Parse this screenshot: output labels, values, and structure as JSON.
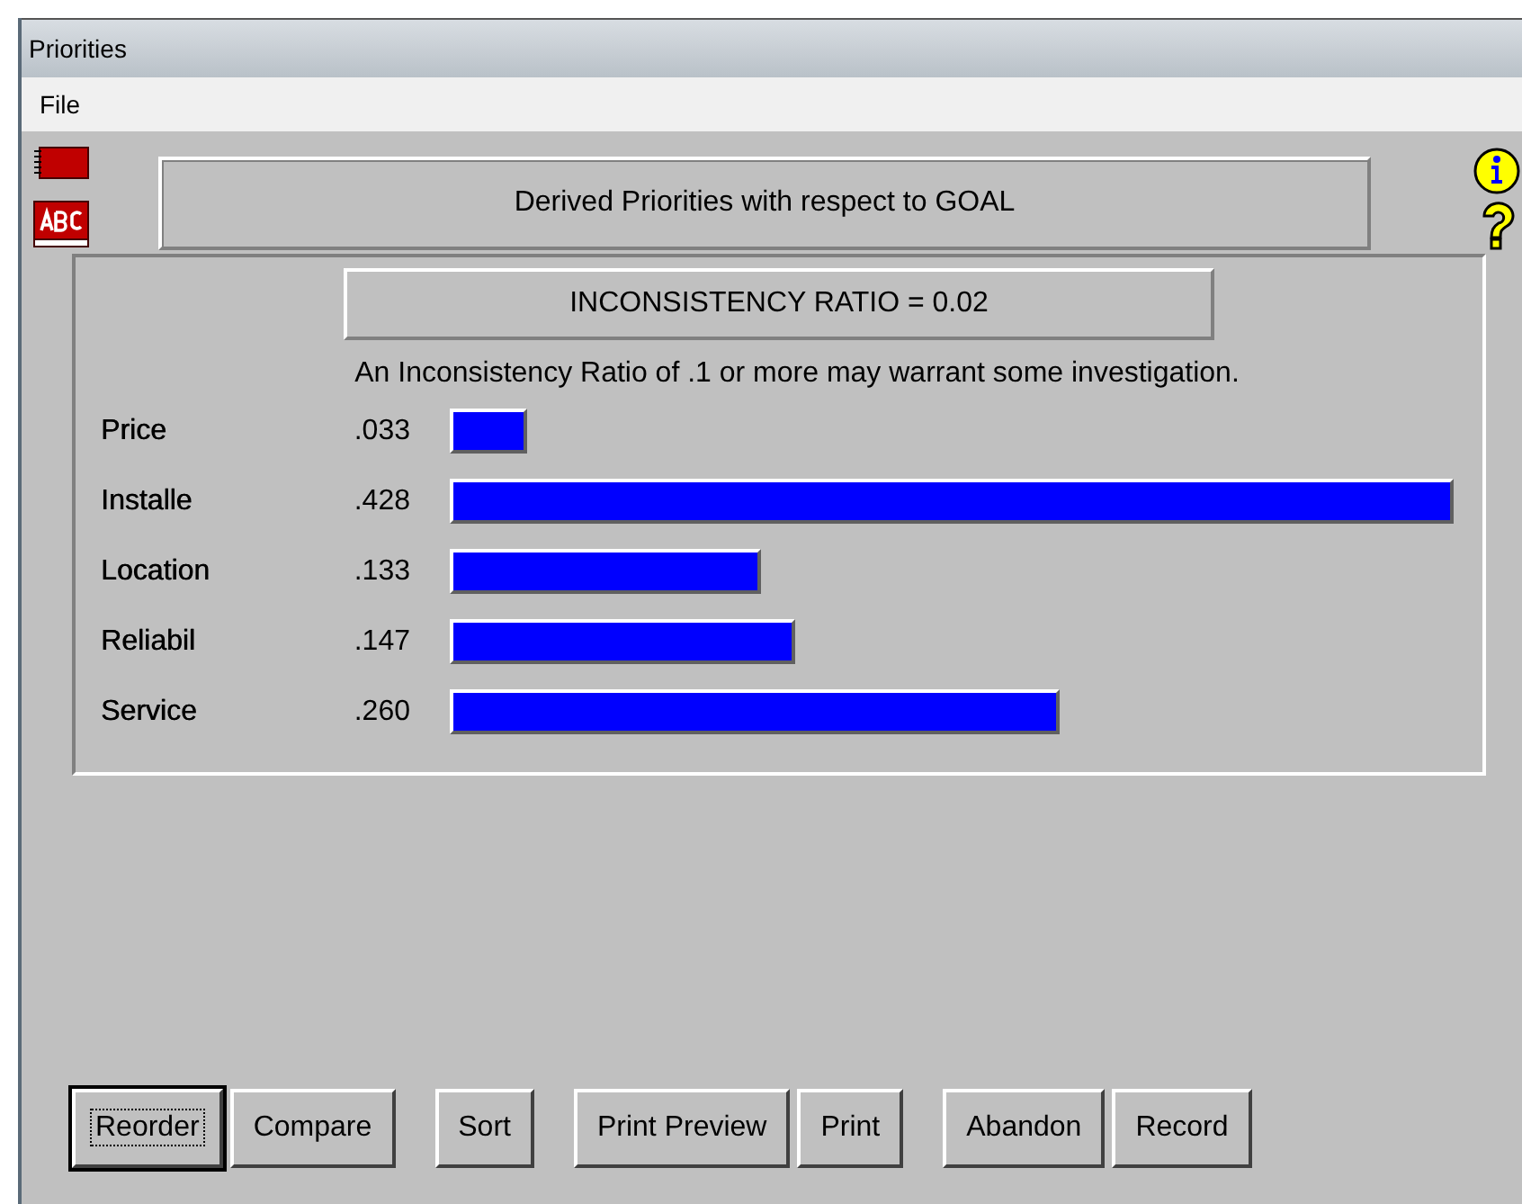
{
  "window": {
    "title": "Priorities"
  },
  "menu": [
    "File"
  ],
  "header": "Derived Priorities with respect to GOAL",
  "ratio": "INCONSISTENCY RATIO = 0.02",
  "note": "An Inconsistency Ratio of .1 or more may warrant some investigation.",
  "priorities": [
    {
      "name": "Price",
      "value": ".033"
    },
    {
      "name": "Installe",
      "value": ".428"
    },
    {
      "name": "Location",
      "value": ".133"
    },
    {
      "name": "Reliabil",
      "value": ".147"
    },
    {
      "name": "Service",
      "value": ".260"
    }
  ],
  "button_groups": [
    [
      {
        "label": "Reorder",
        "focused": true
      },
      {
        "label": "Compare",
        "focused": false
      }
    ],
    [
      {
        "label": "Sort",
        "focused": false
      }
    ],
    [
      {
        "label": "Print Preview",
        "focused": false
      },
      {
        "label": "Print",
        "focused": false
      }
    ],
    [
      {
        "label": "Abandon",
        "focused": false
      },
      {
        "label": "Record",
        "focused": false
      }
    ]
  ]
}
